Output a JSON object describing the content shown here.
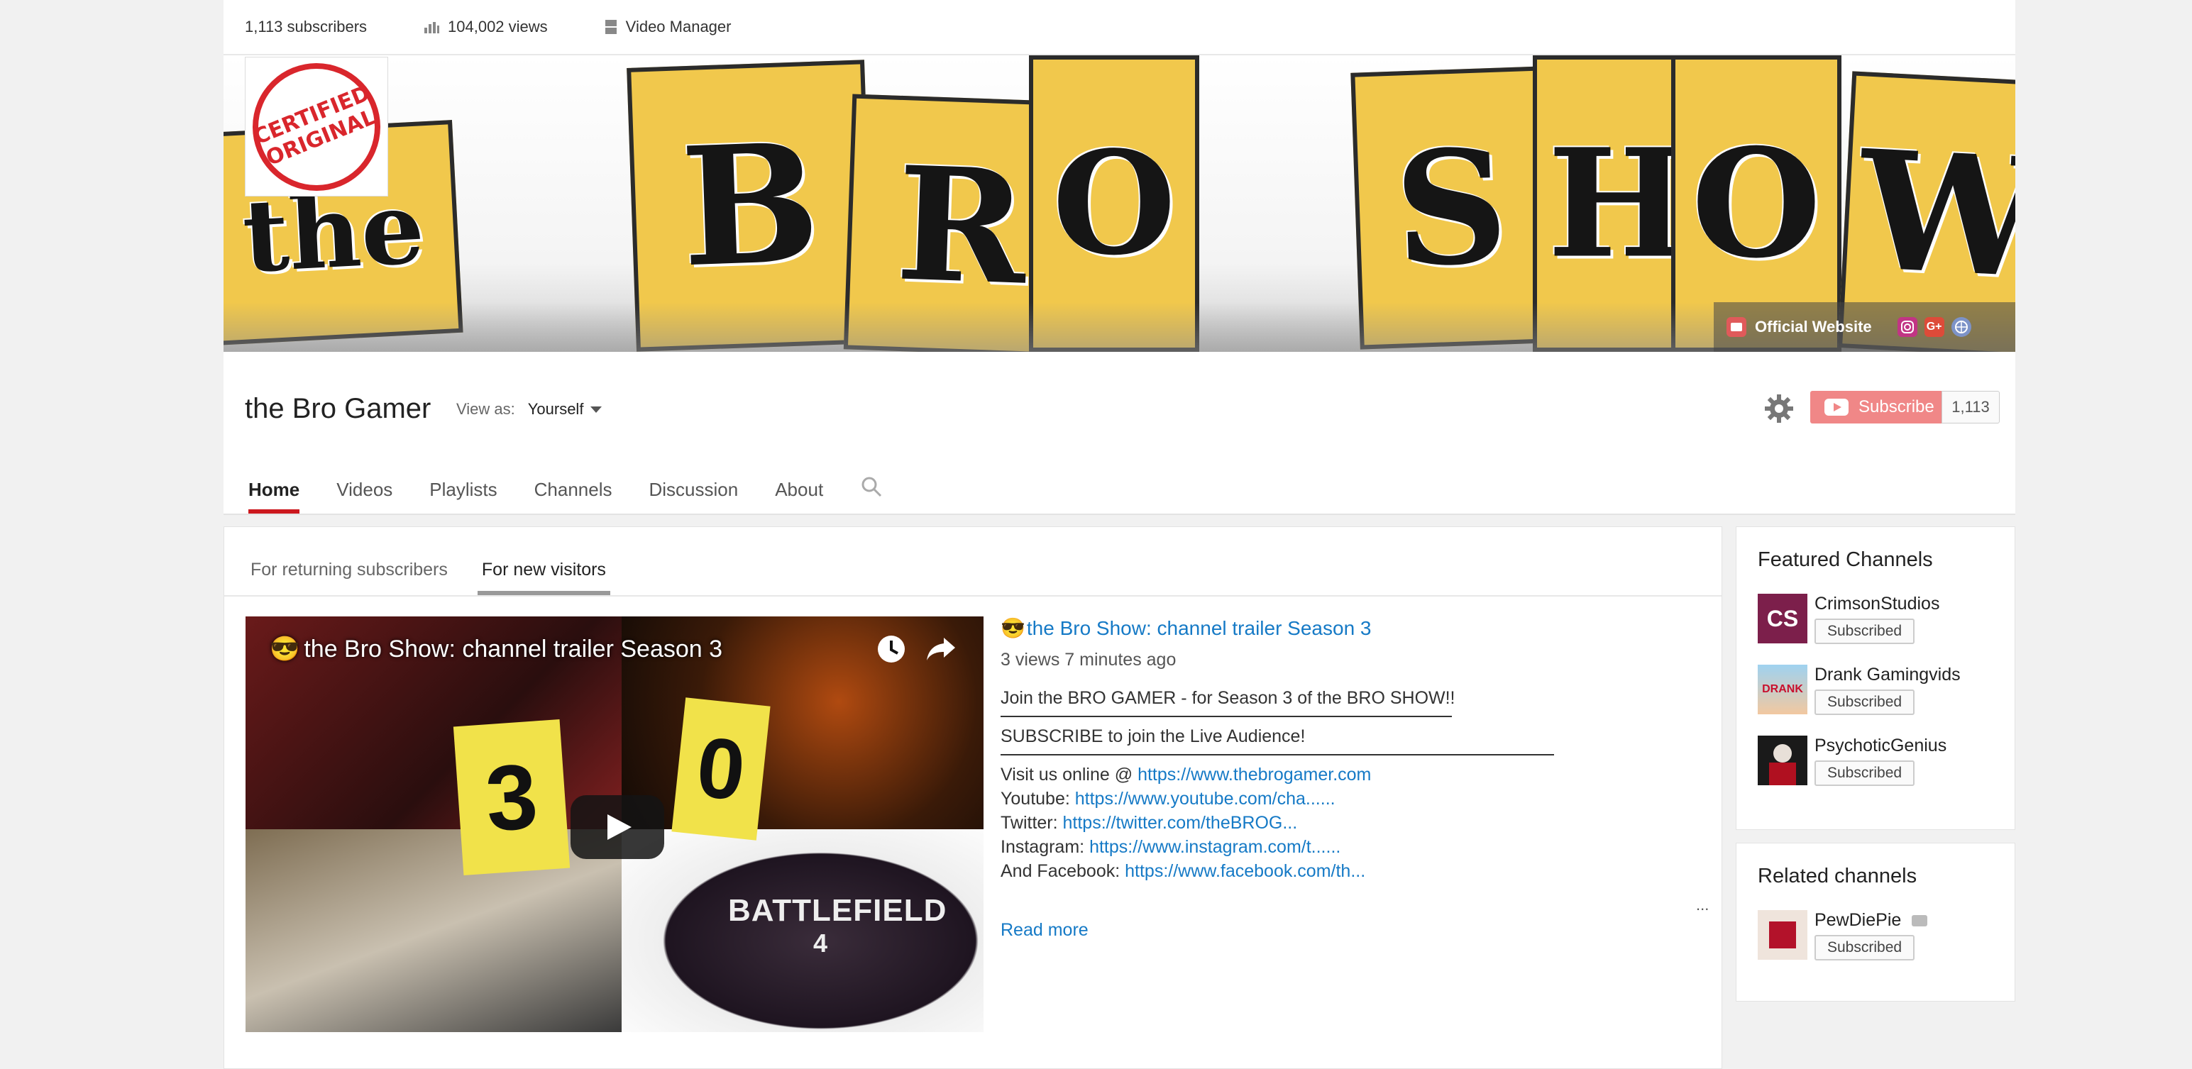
{
  "stats": {
    "subscribers": "1,113 subscribers",
    "views": "104,002 views",
    "video_manager": "Video Manager"
  },
  "banner": {
    "certified_text": "CERTIFIED ORIGINAL",
    "blocks": [
      "the",
      "B",
      "R",
      "O",
      "S",
      "H",
      "O",
      "W"
    ],
    "official_website": "Official Website"
  },
  "channel": {
    "name": "the Bro Gamer",
    "view_as_label": "View as:",
    "view_as_value": "Yourself",
    "subscribe_label": "Subscribe",
    "subscribe_count": "1,113"
  },
  "tabs": [
    "Home",
    "Videos",
    "Playlists",
    "Channels",
    "Discussion",
    "About"
  ],
  "subtabs": [
    "For returning subscribers",
    "For new visitors"
  ],
  "video": {
    "overlay_title": "the Bro Show: channel trailer Season 3",
    "emoji": "😎",
    "title": "the Bro Show: channel trailer Season 3",
    "views": "3 views  7 minutes ago",
    "desc_line1": "Join the BRO GAMER - for Season 3 of the BRO SHOW!!",
    "desc_line2": "SUBSCRIBE to join the Live Audience!",
    "visit_label": "Visit us online @ ",
    "visit_link": "https://www.thebrogamer.com",
    "youtube_label": "Youtube: ",
    "youtube_link": "https://www.youtube.com/cha......",
    "twitter_label": "Twitter: ",
    "twitter_link": "https://twitter.com/theBROG...",
    "instagram_label": "Instagram: ",
    "instagram_link": "https://www.instagram.com/t......",
    "facebook_label": "And Facebook: ",
    "facebook_link": "https://www.facebook.com/th...",
    "more_dots": "...",
    "read_more": "Read more",
    "frame_text_3": "3",
    "frame_text_0": "0",
    "frame_text_bf": "BATTLEFIELD",
    "frame_text_4": "4"
  },
  "featured": {
    "title": "Featured Channels",
    "channels": [
      {
        "name": "CrimsonStudios",
        "button": "Subscribed",
        "thumb_text": "CS"
      },
      {
        "name": "Drank Gamingvids",
        "button": "Subscribed",
        "thumb_text": "DRANK"
      },
      {
        "name": "PsychoticGenius",
        "button": "Subscribed"
      }
    ]
  },
  "related": {
    "title": "Related channels",
    "channels": [
      {
        "name": "PewDiePie",
        "button": "Subscribed"
      }
    ]
  },
  "colors": {
    "accent_red": "#cc181e",
    "link_blue": "#167ac6",
    "banner_yellow": "#f1c84c",
    "subscribe_pink": "#f08787"
  }
}
